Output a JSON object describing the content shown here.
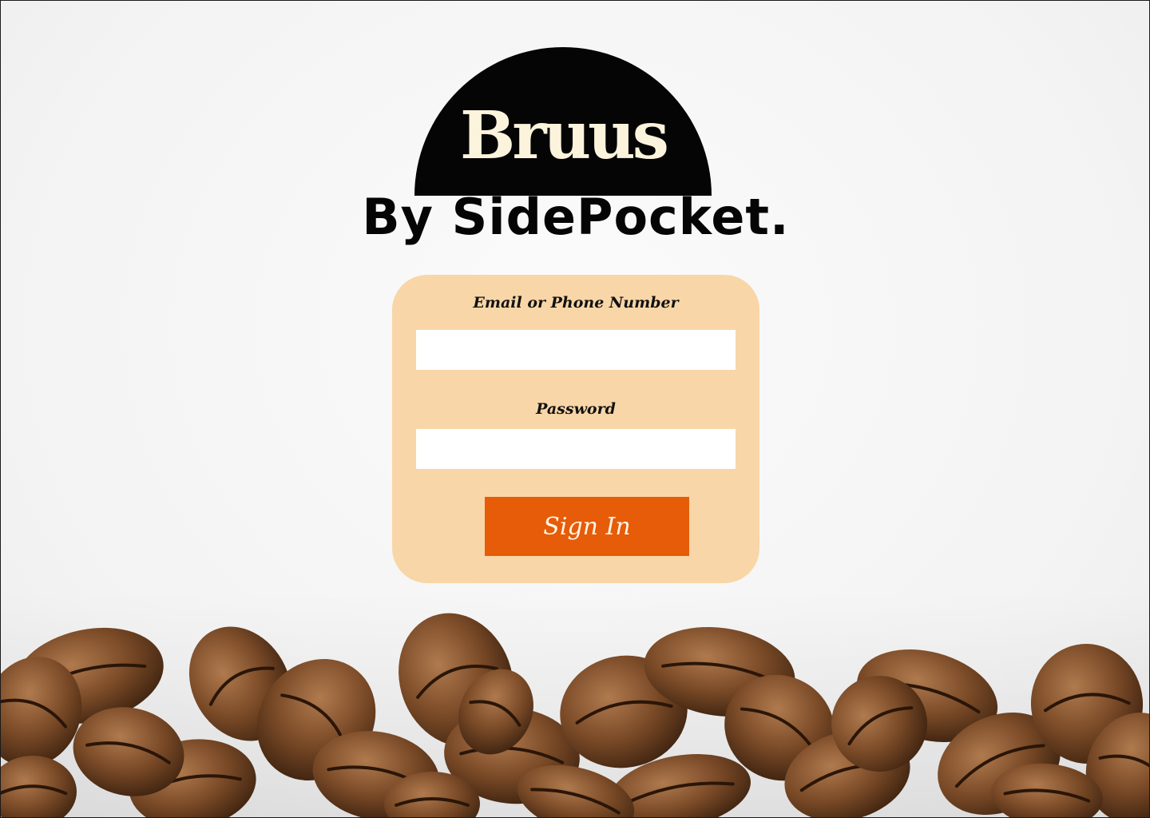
{
  "brand": {
    "name": "Bruus",
    "byline": "By SidePocket."
  },
  "login": {
    "email_label": "Email or Phone Number",
    "email_value": "",
    "password_label": "Password",
    "password_value": "",
    "signin_label": "Sign In"
  },
  "colors": {
    "card": "#f9d6a7",
    "button": "#e65c08",
    "logo": "#050505",
    "logo_text": "#fbf3dc"
  }
}
